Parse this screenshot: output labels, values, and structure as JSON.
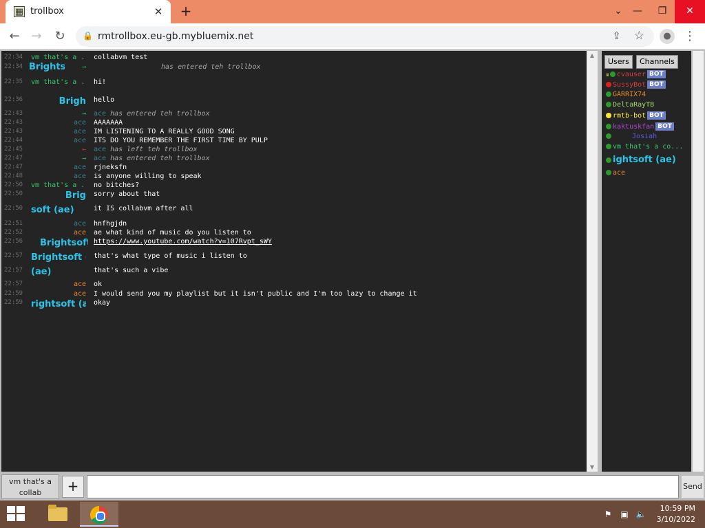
{
  "browser": {
    "tab_title": "trollbox",
    "tab_icon": "trollbox-favicon",
    "url": "rmtrollbox.eu-gb.mybluemix.net",
    "window_buttons": [
      "chevron-down-icon",
      "minimize-icon",
      "restore-icon",
      "close-icon"
    ]
  },
  "chat": {
    "messages": [
      {
        "ts": "22:34",
        "nick": "vm that's a ...",
        "nick_color": "#35c96b",
        "text": "collabvm test",
        "kind": "normal"
      },
      {
        "ts": "22:34",
        "nick": "→",
        "nick_color": "#35c96b",
        "bright_nick": "Brightso",
        "text": "has entered teh trollbox",
        "kind": "join"
      },
      {
        "ts": "22:35",
        "nick": "vm that's a ...",
        "nick_color": "#35c96b",
        "text": "hi!",
        "kind": "normal"
      },
      {
        "ts": "22:36",
        "nick": "Brigh",
        "nick_color": "#2bc4e8",
        "text": "hello",
        "kind": "bright"
      },
      {
        "ts": "22:43",
        "nick": "→",
        "nick_color": "#35c96b",
        "inline_nick": "ace",
        "text": "has entered teh trollbox",
        "kind": "join"
      },
      {
        "ts": "22:43",
        "nick": "ace",
        "nick_color": "#3a7f8f",
        "text": "AAAAAAA",
        "kind": "normal"
      },
      {
        "ts": "22:43",
        "nick": "ace",
        "nick_color": "#3a7f8f",
        "text": "IM LISTENING TO A REALLY GOOD SONG",
        "kind": "normal"
      },
      {
        "ts": "22:44",
        "nick": "ace",
        "nick_color": "#3a7f8f",
        "text": "ITS DO YOU REMEMBER THE FIRST TIME BY PULP",
        "kind": "normal"
      },
      {
        "ts": "22:45",
        "nick": "←",
        "nick_color": "#d83b3b",
        "inline_nick": "ace",
        "text": "has left teh trollbox",
        "kind": "leave"
      },
      {
        "ts": "22:47",
        "nick": "→",
        "nick_color": "#35c96b",
        "inline_nick": "ace",
        "text": "has entered teh trollbox",
        "kind": "join"
      },
      {
        "ts": "22:47",
        "nick": "ace",
        "nick_color": "#3a7f8f",
        "text": "rjneksfn",
        "kind": "normal"
      },
      {
        "ts": "22:48",
        "nick": "ace",
        "nick_color": "#3a7f8f",
        "text": "is anyone willing to speak",
        "kind": "normal"
      },
      {
        "ts": "22:50",
        "nick": "vm that's a ...",
        "nick_color": "#35c96b",
        "text": "no bitches?",
        "kind": "normal"
      },
      {
        "ts": "22:50",
        "nick": "Brig",
        "nick_color": "#2bc4e8",
        "text": "sorry about that",
        "kind": "bright"
      },
      {
        "ts": "22:50",
        "nick": "soft (ae)",
        "nick_color": "#2bc4e8",
        "text": "it IS collabvm after all",
        "kind": "bright"
      },
      {
        "ts": "22:51",
        "nick": "ace",
        "nick_color": "#3a7f8f",
        "text": "hnfhgjdn",
        "kind": "normal"
      },
      {
        "ts": "22:52",
        "nick": "ace",
        "nick_color": "#e8872b",
        "text": "ae what kind of music do you listen to",
        "kind": "normal"
      },
      {
        "ts": "22:56",
        "nick": "Brightsoft",
        "nick_color": "#2bc4e8",
        "text": "https://www.youtube.com/watch?v=107Rvpt_sWY",
        "kind": "link"
      },
      {
        "ts": "22:57",
        "nick": "Brightsoft (a",
        "nick_color": "#2bc4e8",
        "text": "that's what type of music i listen to",
        "kind": "bright"
      },
      {
        "ts": "22:57",
        "nick": "(ae)",
        "nick_color": "#2bc4e8",
        "text": "that's such a vibe",
        "kind": "bright"
      },
      {
        "ts": "22:57",
        "nick": "ace",
        "nick_color": "#e8872b",
        "text": "ok",
        "kind": "normal"
      },
      {
        "ts": "22:59",
        "nick": "ace",
        "nick_color": "#e8872b",
        "text": "I would send you my playlist but it isn't public and I'm too lazy to change it",
        "kind": "normal"
      },
      {
        "ts": "22:59",
        "nick": "rightsoft (ae",
        "nick_color": "#2bc4e8",
        "text": "okay",
        "kind": "bright"
      }
    ]
  },
  "sidebar": {
    "tabs": [
      "Users",
      "Channels"
    ],
    "users": [
      {
        "name": "cvauser",
        "color": "#d83b3b",
        "dot": "#2a9a2a",
        "crown": true,
        "bot": true
      },
      {
        "name": "SussyBot",
        "color": "#d83b3b",
        "dot": "#e02020",
        "crown": false,
        "bot": true
      },
      {
        "name": "GARRIX74",
        "color": "#e8872b",
        "dot": "#2a9a2a",
        "crown": false,
        "bot": false
      },
      {
        "name": "DeltaRayTB",
        "color": "#9fd66b",
        "dot": "#2a9a2a",
        "crown": false,
        "bot": false
      },
      {
        "name": "rmtb-bot",
        "color": "#f4e642",
        "dot": "#f4e642",
        "crown": false,
        "bot": true
      },
      {
        "name": "kaktuskfan",
        "color": "#b04ad0",
        "dot": "#2a9a2a",
        "crown": false,
        "bot": true
      },
      {
        "name": "Josiah",
        "color": "#5a5ad8",
        "dot": "#2a9a2a",
        "crown": false,
        "bot": false
      },
      {
        "name": "vm that's a co...",
        "color": "#35c96b",
        "dot": "#2a9a2a",
        "crown": false,
        "bot": false
      },
      {
        "name": "ightsoft (ae)",
        "color": "#2bc4e8",
        "dot": "#2a9a2a",
        "crown": false,
        "bot": false
      },
      {
        "name": "ace",
        "color": "#e8872b",
        "dot": "#2a9a2a",
        "crown": false,
        "bot": false
      }
    ],
    "bot_label": "BOT"
  },
  "input": {
    "room_label": "vm that's a collab",
    "add_label": "+",
    "placeholder": "",
    "send_label": "Send"
  },
  "taskbar": {
    "time": "10:59 PM",
    "date": "3/10/2022"
  }
}
